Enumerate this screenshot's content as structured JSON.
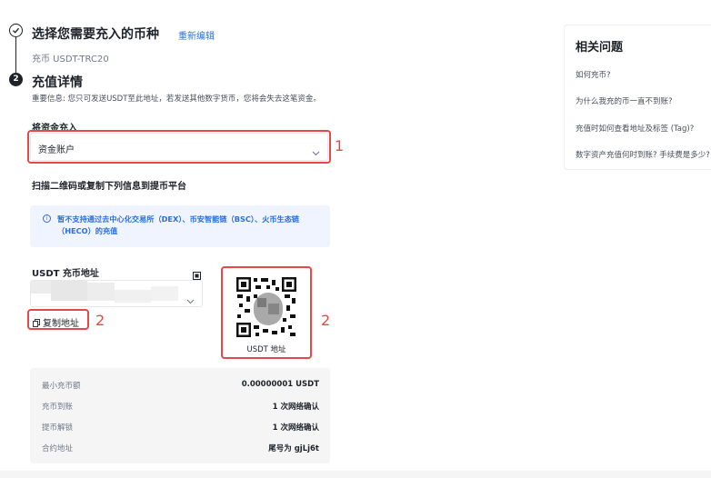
{
  "step1": {
    "number": "",
    "title": "选择您需要充入的币种",
    "edit_link": "重新编辑",
    "selected_coin": "充币 USDT-TRC20"
  },
  "step2": {
    "number": "2",
    "title": "充值详情",
    "notice": "重要信息: 您只可发送USDT至此地址，若发送其他数字货币，您将会失去这笔资金。"
  },
  "account": {
    "label": "将资金充入",
    "selected": "资金账户",
    "annotation": "1"
  },
  "scan_instruction": "扫描二维码或复制下列信息到提币平台",
  "info_notice": {
    "icon_text": "i",
    "text": "暂不支持通过去中心化交易所（DEX）、币安智能链（BSC）、火币生态链（HECO）的充值"
  },
  "address": {
    "label": "USDT 充币地址",
    "copy_label": "复制地址",
    "copy_annotation": "2"
  },
  "qr": {
    "caption": "USDT 地址",
    "annotation": "2"
  },
  "details": [
    {
      "key": "最小充币额",
      "value": "0.00000001 USDT"
    },
    {
      "key": "充币到账",
      "value": "1 次网络确认"
    },
    {
      "key": "提币解锁",
      "value": "1 次网络确认"
    },
    {
      "key": "合约地址",
      "value": "尾号为 gjLj6t"
    }
  ],
  "faq": {
    "title": "相关问题",
    "items": [
      "如何充币?",
      "为什么我充的币一直不到账?",
      "充值时如何查看地址及标签 (Tag)?",
      "数字资产充值何时到账? 手续费是多少?"
    ]
  },
  "colors": {
    "accent_link": "#2b6fd6",
    "annotation_red": "#e54848",
    "info_bg": "#eff4ff"
  }
}
